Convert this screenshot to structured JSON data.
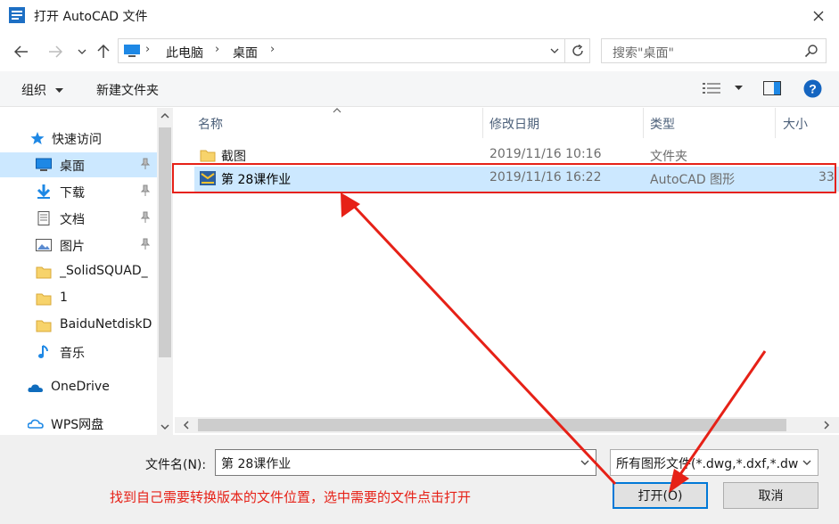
{
  "window": {
    "title": "打开 AutoCAD 文件"
  },
  "address": {
    "crumbs": [
      "此电脑",
      "桌面"
    ]
  },
  "search": {
    "placeholder": "搜索\"桌面\""
  },
  "toolbar": {
    "organize": "组织",
    "new_folder": "新建文件夹"
  },
  "sidebar": {
    "items": [
      {
        "label": "快速访问",
        "icon": "star-icon"
      },
      {
        "label": "桌面",
        "icon": "desktop-icon"
      },
      {
        "label": "下载",
        "icon": "download-icon"
      },
      {
        "label": "文档",
        "icon": "document-icon"
      },
      {
        "label": "图片",
        "icon": "picture-icon"
      },
      {
        "label": "_SolidSQUAD_",
        "icon": "folder-icon"
      },
      {
        "label": "1",
        "icon": "folder-icon"
      },
      {
        "label": "BaiduNetdiskD",
        "icon": "folder-icon"
      },
      {
        "label": "音乐",
        "icon": "music-icon"
      },
      {
        "label": "OneDrive",
        "icon": "cloud-icon"
      },
      {
        "label": "WPS网盘",
        "icon": "cloud-icon"
      }
    ]
  },
  "columns": {
    "name": "名称",
    "date": "修改日期",
    "type": "类型",
    "size": "大小"
  },
  "files": [
    {
      "name": "截图",
      "date": "2019/11/16 10:16",
      "type": "文件夹",
      "size": ""
    },
    {
      "name": "第 28课作业",
      "date": "2019/11/16 16:22",
      "type": "AutoCAD 图形",
      "size": "33"
    }
  ],
  "bottom": {
    "filename_label": "文件名(N):",
    "filename_value": "第 28课作业",
    "filetype_value": "所有图形文件(*.dwg,*.dxf,*.dw",
    "open_label": "打开(O)",
    "cancel_label": "取消",
    "annotation": "找到自己需要转换版本的文件位置，选中需要的文件点击打开"
  },
  "colors": {
    "accent": "#0078d7",
    "selection": "#cce8ff",
    "annotation_red": "#e62117"
  }
}
